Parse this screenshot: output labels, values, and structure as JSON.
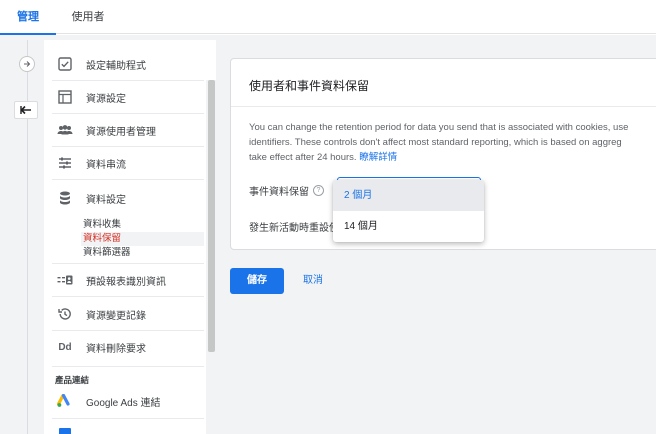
{
  "tabs": {
    "admin": "管理",
    "users": "使用者"
  },
  "nav": {
    "items": [
      {
        "label": "設定輔助程式",
        "icon": "checkbox-icon"
      },
      {
        "label": "資源設定",
        "icon": "property-icon"
      },
      {
        "label": "資源使用者管理",
        "icon": "people-icon"
      },
      {
        "label": "資料串流",
        "icon": "streams-icon"
      },
      {
        "label": "資料設定",
        "icon": "database-icon"
      },
      {
        "label": "預設報表識別資訊",
        "icon": "identity-icon"
      },
      {
        "label": "資源變更記錄",
        "icon": "history-icon"
      },
      {
        "label": "資料刪除要求",
        "icon": "dd-icon"
      },
      {
        "label": "Google Ads 連結",
        "icon": "google-ads-icon"
      }
    ],
    "sub_items": [
      "資料收集",
      "資料保留",
      "資料篩選器"
    ],
    "section_label": "產品連結",
    "dd_glyph": "Dd"
  },
  "card": {
    "title": "使用者和事件資料保留",
    "desc_line1": "You can change the retention period for data you send that is associated with cookies, use",
    "desc_line2": "identifiers. These controls don't affect most standard reporting, which is based on aggreg",
    "desc_line3": "take effect after 24 hours.",
    "learn_more": "瞭解詳情",
    "event_retention_label": "事件資料保留",
    "help_glyph": "?",
    "reset_label": "發生新活動時重設使"
  },
  "dropdown": {
    "options": [
      "2 個月",
      "14 個月"
    ],
    "selected_index": 0
  },
  "actions": {
    "save": "儲存",
    "cancel": "取消"
  },
  "colors": {
    "accent": "#1a73e8",
    "active_sub": "#d93025",
    "bg": "#f1f3f4"
  }
}
